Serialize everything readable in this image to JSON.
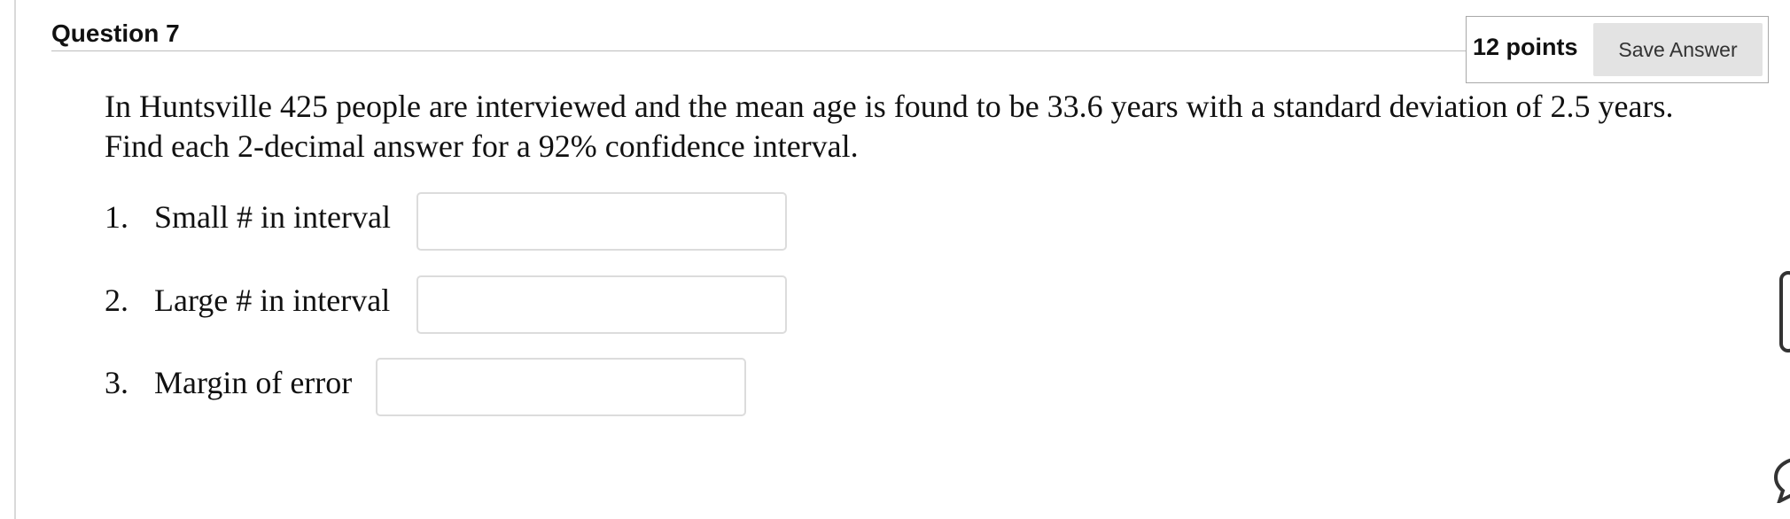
{
  "question": {
    "title": "Question 7",
    "points": "12 points",
    "save_label": "Save Answer",
    "text": "In Huntsville 425 people are interviewed and the mean age is found to be 33.6 years with a standard deviation of 2.5 years.  Find each 2-decimal answer for a 92% confidence interval."
  },
  "items": [
    {
      "number": "1.",
      "label": "Small # in interval",
      "value": ""
    },
    {
      "number": "2.",
      "label": "Large # in interval",
      "value": ""
    },
    {
      "number": "3.",
      "label": "Margin of error",
      "value": ""
    }
  ],
  "icons": {
    "side_tab": "side-panel-tab-icon",
    "chat": "chat-bubble-icon"
  }
}
